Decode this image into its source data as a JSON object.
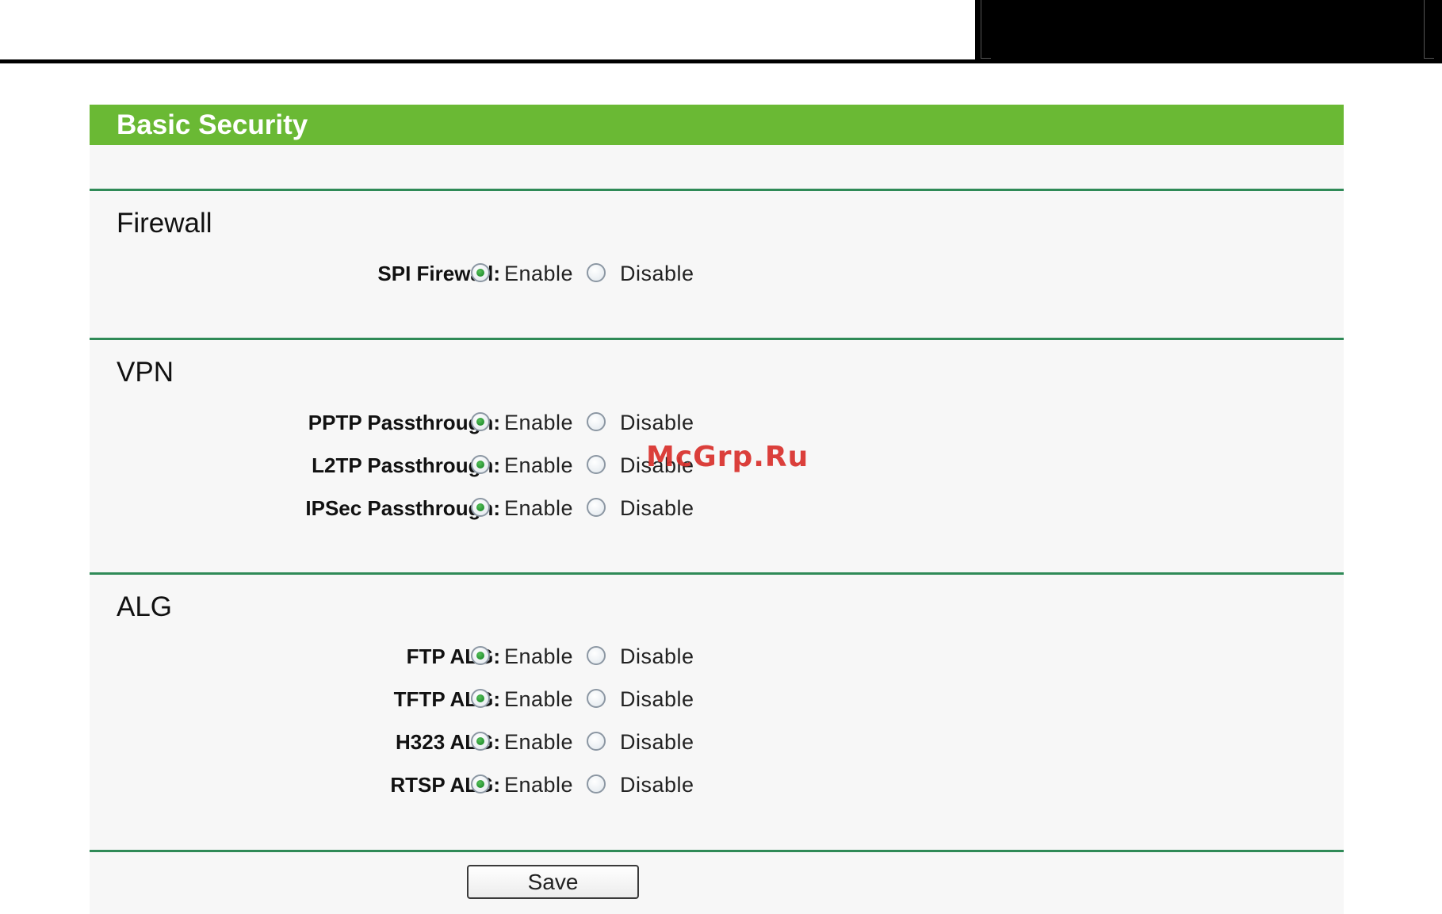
{
  "panel": {
    "title": "Basic Security"
  },
  "sections": {
    "firewall": {
      "title": "Firewall",
      "rows": {
        "spi_firewall": {
          "label": "SPI Firewall:",
          "selected": "Enable"
        }
      }
    },
    "vpn": {
      "title": "VPN",
      "rows": {
        "pptp": {
          "label": "PPTP Passthrough:",
          "selected": "Enable"
        },
        "l2tp": {
          "label": "L2TP Passthrough:",
          "selected": "Enable"
        },
        "ipsec": {
          "label": "IPSec Passthrough:",
          "selected": "Enable"
        }
      }
    },
    "alg": {
      "title": "ALG",
      "rows": {
        "ftp": {
          "label": "FTP ALG:",
          "selected": "Enable"
        },
        "tftp": {
          "label": "TFTP ALG:",
          "selected": "Enable"
        },
        "h323": {
          "label": "H323 ALG:",
          "selected": "Enable"
        },
        "rtsp": {
          "label": "RTSP ALG:",
          "selected": "Enable"
        }
      }
    }
  },
  "options": {
    "enable": "Enable",
    "disable": "Disable"
  },
  "buttons": {
    "save": "Save"
  },
  "watermark": "McGrp.Ru",
  "colors": {
    "header_green": "#6ab934",
    "divider_green": "#2f8a57",
    "radio_dot_green": "#1e8c2c",
    "watermark_red": "#d9302c"
  }
}
